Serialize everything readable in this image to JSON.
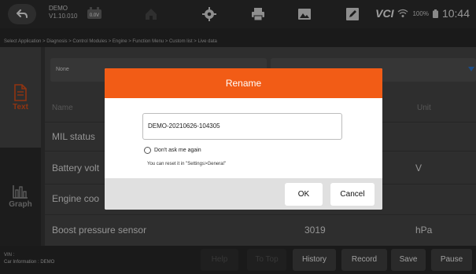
{
  "topbar": {
    "app_name": "DEMO",
    "version": "V1.10.010",
    "version_badge": "0.0V",
    "vci_label": "VCI",
    "battery_text": "100%",
    "time": "10:44"
  },
  "breadcrumb": "Select Application > Diagnosis > Control Modules > Engine > Function Menu > Custom list > Live data",
  "sidebar": {
    "items": [
      {
        "label": "Text",
        "icon": "document-icon",
        "selected": true
      },
      {
        "label": "Graph",
        "icon": "bar-graph-icon",
        "selected": false
      }
    ]
  },
  "filters": {
    "left_value": "None",
    "right_value": ""
  },
  "table": {
    "headers": {
      "name": "Name",
      "value": "",
      "unit": "Unit"
    },
    "rows": [
      {
        "name": "MIL status",
        "value": "",
        "unit": ""
      },
      {
        "name": "Battery volt",
        "value": "",
        "unit": "V"
      },
      {
        "name": "Engine coo",
        "value": "",
        "unit": ""
      },
      {
        "name": "Boost pressure sensor",
        "value": "3019",
        "unit": "hPa"
      }
    ]
  },
  "bottombar": {
    "vin_label": "VIN :",
    "car_info": "Car Information : DEMO",
    "buttons": [
      {
        "label": "Help",
        "enabled": false
      },
      {
        "label": "To Top",
        "enabled": false
      },
      {
        "label": "History",
        "enabled": true
      },
      {
        "label": "Record",
        "enabled": true
      },
      {
        "label": "Save",
        "enabled": true
      },
      {
        "label": "Pause",
        "enabled": true
      }
    ]
  },
  "dialog": {
    "title": "Rename",
    "input_value": "DEMO-20210626-104305",
    "dont_ask_label": "Don't ask me again",
    "reset_note": "You can reset it in \"Settings>General\"",
    "ok_label": "OK",
    "cancel_label": "Cancel"
  },
  "colors": {
    "accent": "#f25c16",
    "dropdown_caret": "#2c7bd8"
  }
}
